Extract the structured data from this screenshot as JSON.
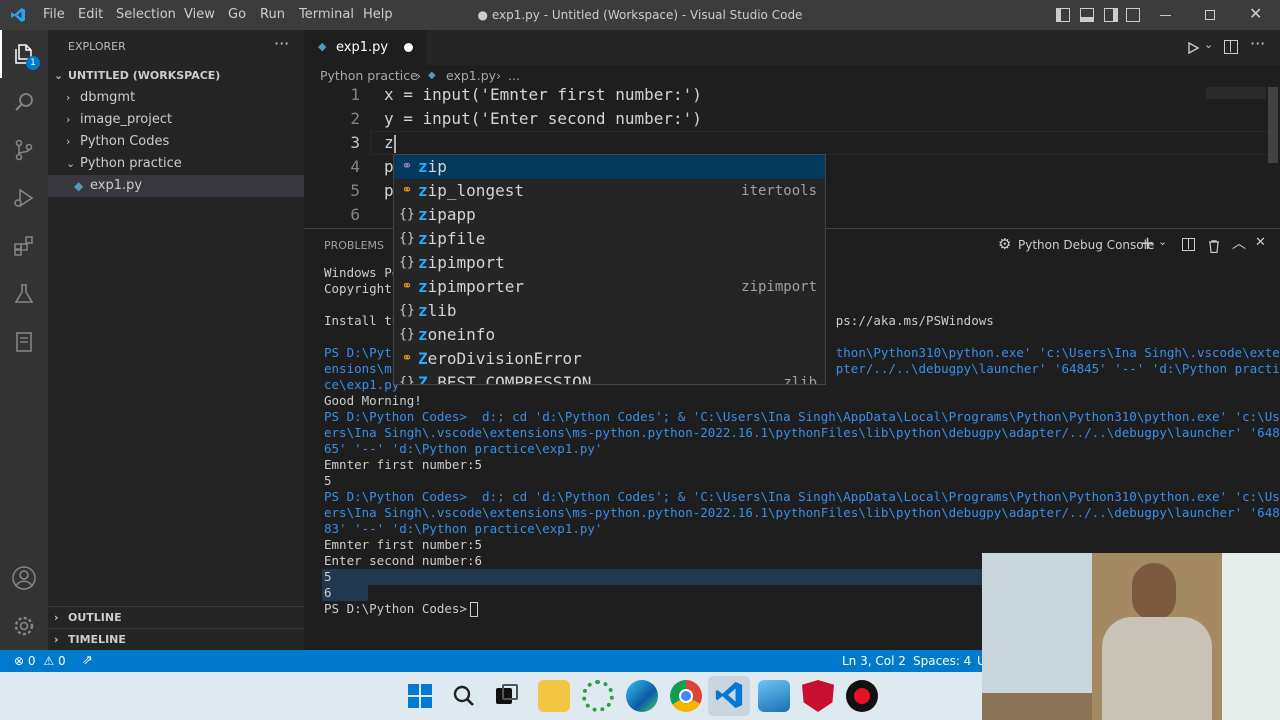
{
  "titlebar": {
    "menu": [
      "File",
      "Edit",
      "Selection",
      "View",
      "Go",
      "Run",
      "Terminal",
      "Help"
    ],
    "title": "● exp1.py - Untitled (Workspace) - Visual Studio Code"
  },
  "activity": {
    "badge": "1"
  },
  "sidebar": {
    "header": "EXPLORER",
    "workspace": "UNTITLED (WORKSPACE)",
    "items": [
      {
        "label": "dbmgmt",
        "icon": "chevron-right"
      },
      {
        "label": "image_project",
        "icon": "chevron-right"
      },
      {
        "label": "Python Codes",
        "icon": "chevron-right"
      },
      {
        "label": "Python practice",
        "icon": "chevron-down"
      },
      {
        "label": "exp1.py",
        "icon": "python-file"
      }
    ],
    "outline": "OUTLINE",
    "timeline": "TIMELINE"
  },
  "editor": {
    "tab_label": "exp1.py",
    "breadcrumb": [
      "Python practice",
      "exp1.py",
      "..."
    ],
    "lines": [
      {
        "n": "1",
        "text": "x = input('Emnter first number:')"
      },
      {
        "n": "2",
        "text": "y = input('Enter second number:')"
      },
      {
        "n": "3",
        "text": "z"
      },
      {
        "n": "4",
        "text": "p"
      },
      {
        "n": "5",
        "text": "p"
      },
      {
        "n": "6",
        "text": ""
      }
    ]
  },
  "suggest": {
    "items": [
      {
        "label": "zip",
        "hl": "z",
        "rest": "ip",
        "icon": "method-icon",
        "detail": ""
      },
      {
        "label": "zip_longest",
        "hl": "z",
        "rest": "ip_longest",
        "icon": "class-icon",
        "detail": "itertools"
      },
      {
        "label": "zipapp",
        "hl": "z",
        "rest": "ipapp",
        "icon": "module-icon",
        "detail": ""
      },
      {
        "label": "zipfile",
        "hl": "z",
        "rest": "ipfile",
        "icon": "module-icon",
        "detail": ""
      },
      {
        "label": "zipimport",
        "hl": "z",
        "rest": "ipimport",
        "icon": "module-icon",
        "detail": ""
      },
      {
        "label": "zipimporter",
        "hl": "z",
        "rest": "ipimporter",
        "icon": "class-icon",
        "detail": "zipimport"
      },
      {
        "label": "zlib",
        "hl": "z",
        "rest": "lib",
        "icon": "module-icon",
        "detail": ""
      },
      {
        "label": "zoneinfo",
        "hl": "z",
        "rest": "oneinfo",
        "icon": "module-icon",
        "detail": ""
      },
      {
        "label": "ZeroDivisionError",
        "hl": "Z",
        "rest": "eroDivisionError",
        "icon": "class-icon",
        "detail": ""
      },
      {
        "label": "Z_BEST_COMPRESSION",
        "hl": "Z",
        "rest": "_BEST_COMPRESSION",
        "icon": "module-icon",
        "detail": "zlib"
      }
    ]
  },
  "panel": {
    "tab_problems": "PROBLEMS",
    "console_label": "Python Debug Console",
    "lines": [
      "Windows Po",
      "Copyright ",
      "",
      "Install th                                                          ps://aka.ms/PSWindows",
      "",
      "PS D:\\Pyth                                                          thon\\Python310\\python.exe' 'c:\\Users\\Ina Singh\\.vscode\\exte",
      "ensions\\ms-                                                         pter/../..\\debugpy\\launcher' '64845' '--' 'd:\\Python practi",
      "ce\\exp1.py",
      "Good Morning!",
      "PS D:\\Python Codes>  d:; cd 'd:\\Python Codes'; & 'C:\\Users\\Ina Singh\\AppData\\Local\\Programs\\Python\\Python310\\python.exe' 'c:\\Us",
      "ers\\Ina Singh\\.vscode\\extensions\\ms-python.python-2022.16.1\\pythonFiles\\lib\\python\\debugpy\\adapter/../..\\debugpy\\launcher' '648",
      "65' '--' 'd:\\Python practice\\exp1.py'",
      "Emnter first number:5",
      "5",
      "PS D:\\Python Codes>  d:; cd 'd:\\Python Codes'; & 'C:\\Users\\Ina Singh\\AppData\\Local\\Programs\\Python\\Python310\\python.exe' 'c:\\Us",
      "ers\\Ina Singh\\.vscode\\extensions\\ms-python.python-2022.16.1\\pythonFiles\\lib\\python\\debugpy\\adapter/../..\\debugpy\\launcher' '648",
      "83' '--' 'd:\\Python practice\\exp1.py'",
      "Emnter first number:5",
      "Enter second number:6",
      "5",
      "6",
      "PS D:\\Python Codes> "
    ]
  },
  "statusbar": {
    "errors": "0",
    "warnings": "0",
    "position": "Ln 3, Col 2",
    "spaces": "Spaces: 4",
    "extra": "U"
  },
  "colors": {
    "accent": "#007acc",
    "titlebar": "#3c3c3c",
    "sidebar": "#252526",
    "editor": "#1e1e1e"
  }
}
